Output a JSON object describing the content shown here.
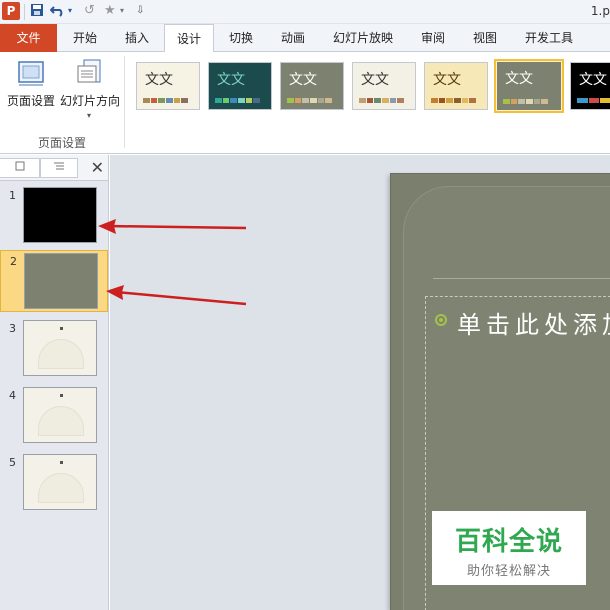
{
  "app": {
    "logo_letter": "P",
    "doc_title": "1.p"
  },
  "qat": {
    "save_icon": "save-icon",
    "undo_icon": "undo-icon",
    "redo_icon": "redo-icon",
    "star_icon": "star-icon",
    "customize_icon": "customize-icon"
  },
  "tabs": [
    {
      "label": "文件"
    },
    {
      "label": "开始"
    },
    {
      "label": "插入"
    },
    {
      "label": "设计"
    },
    {
      "label": "切换"
    },
    {
      "label": "动画"
    },
    {
      "label": "幻灯片放映"
    },
    {
      "label": "审阅"
    },
    {
      "label": "视图"
    },
    {
      "label": "开发工具"
    }
  ],
  "ribbon": {
    "page_setup_label": "页面设置",
    "orientation_label": "幻灯片方向",
    "orientation_dropdown": "▾",
    "group_label": "页面设置",
    "themes": [
      {
        "text": "文文",
        "bg": "#f6f3e4",
        "fg": "#333333"
      },
      {
        "text": "文文",
        "bg": "#1b4b4d",
        "fg": "#7fd3c2"
      },
      {
        "text": "文文",
        "bg": "#7d8170",
        "fg": "#ffffff"
      },
      {
        "text": "文文",
        "bg": "#f3f1e6",
        "fg": "#333333"
      },
      {
        "text": "文文",
        "bg": "#f7e8b8",
        "fg": "#5a3a10"
      },
      {
        "text": "文文",
        "bg": "#7d8170",
        "fg": "#ffffff"
      },
      {
        "text": "文文",
        "bg": "#000000",
        "fg": "#ffffff"
      }
    ]
  },
  "slides_pane": {
    "close_label": "✕",
    "slides": [
      {
        "number": "1"
      },
      {
        "number": "2"
      },
      {
        "number": "3"
      },
      {
        "number": "4"
      },
      {
        "number": "5"
      }
    ]
  },
  "slide": {
    "placeholder_text": "单击此处添加"
  },
  "watermark": {
    "main": "百科全说",
    "sub": "助你轻松解决"
  },
  "colors": {
    "file_tab": "#d24726",
    "arrow": "#cc1f1f",
    "selected_slide": "#fbd984"
  }
}
